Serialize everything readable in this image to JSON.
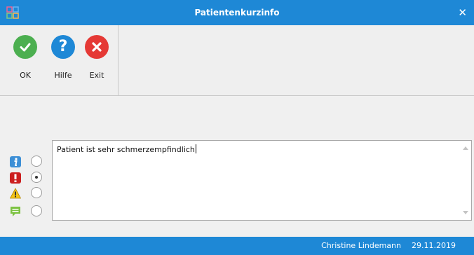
{
  "window": {
    "title": "Patientenkurzinfo",
    "close_icon": "close-icon",
    "app_icon": "app-grid-icon",
    "title_color": "#1e88d6"
  },
  "toolbar": {
    "buttons": [
      {
        "label": "OK",
        "icon": "checkmark-icon",
        "color": "#4caf50"
      },
      {
        "label": "Hilfe",
        "icon": "question-icon",
        "color": "#1e88d6"
      },
      {
        "label": "Exit",
        "icon": "x-icon",
        "color": "#e53935"
      }
    ]
  },
  "priority": {
    "options": [
      {
        "icon": "info-icon",
        "selected": false
      },
      {
        "icon": "exclamation-icon",
        "selected": true
      },
      {
        "icon": "warning-icon",
        "selected": false
      },
      {
        "icon": "comment-icon",
        "selected": false
      }
    ]
  },
  "memo": {
    "text": "Patient ist sehr schmerzempfindlich"
  },
  "status": {
    "user": "Christine Lindemann",
    "date": "29.11.2019"
  }
}
